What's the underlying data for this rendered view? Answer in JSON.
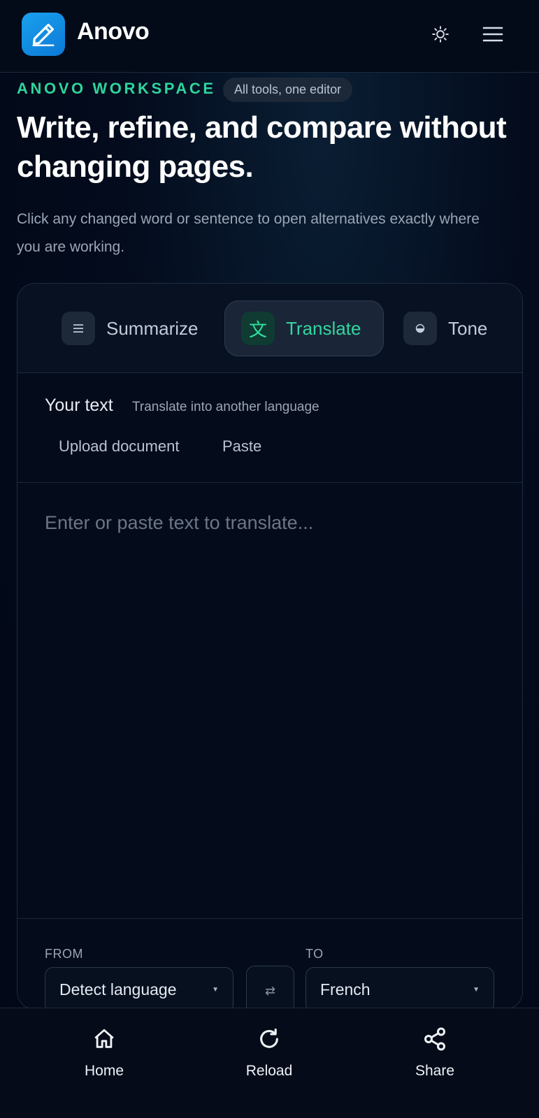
{
  "app": {
    "name": "Anovo"
  },
  "colors": {
    "accent": "#2fd49c",
    "brand": "#0b8fe6",
    "background": "#020818"
  },
  "icons": {
    "logo": "pencil-icon",
    "theme": "sun-icon",
    "menu": "hamburger-icon",
    "home": "home-icon",
    "reload": "reload-icon",
    "share": "share-icon"
  },
  "hero": {
    "eyebrow": "ANOVO WORKSPACE",
    "pill": "All tools, one editor",
    "title": "Write, refine, and compare without changing pages.",
    "subtitle": "Click any changed word or sentence to open alternatives exactly where you are working."
  },
  "tabs": [
    {
      "label": "Summarize",
      "icon": "lines-icon",
      "active": false
    },
    {
      "label": "Translate",
      "icon": "translate-icon",
      "glyph": "文",
      "active": true
    },
    {
      "label": "Tone",
      "icon": "dot-icon",
      "active": false
    }
  ],
  "editor": {
    "heading": "Your text",
    "hint": "Translate into another language",
    "upload_label": "Upload document",
    "paste_label": "Paste",
    "placeholder": "Enter or paste text to translate..."
  },
  "language": {
    "from_label": "FROM",
    "to_label": "TO",
    "from_value": "Detect language",
    "to_value": "French",
    "swap_glyph": "⇄"
  },
  "bottom_nav": {
    "home": "Home",
    "reload": "Reload",
    "share": "Share"
  }
}
